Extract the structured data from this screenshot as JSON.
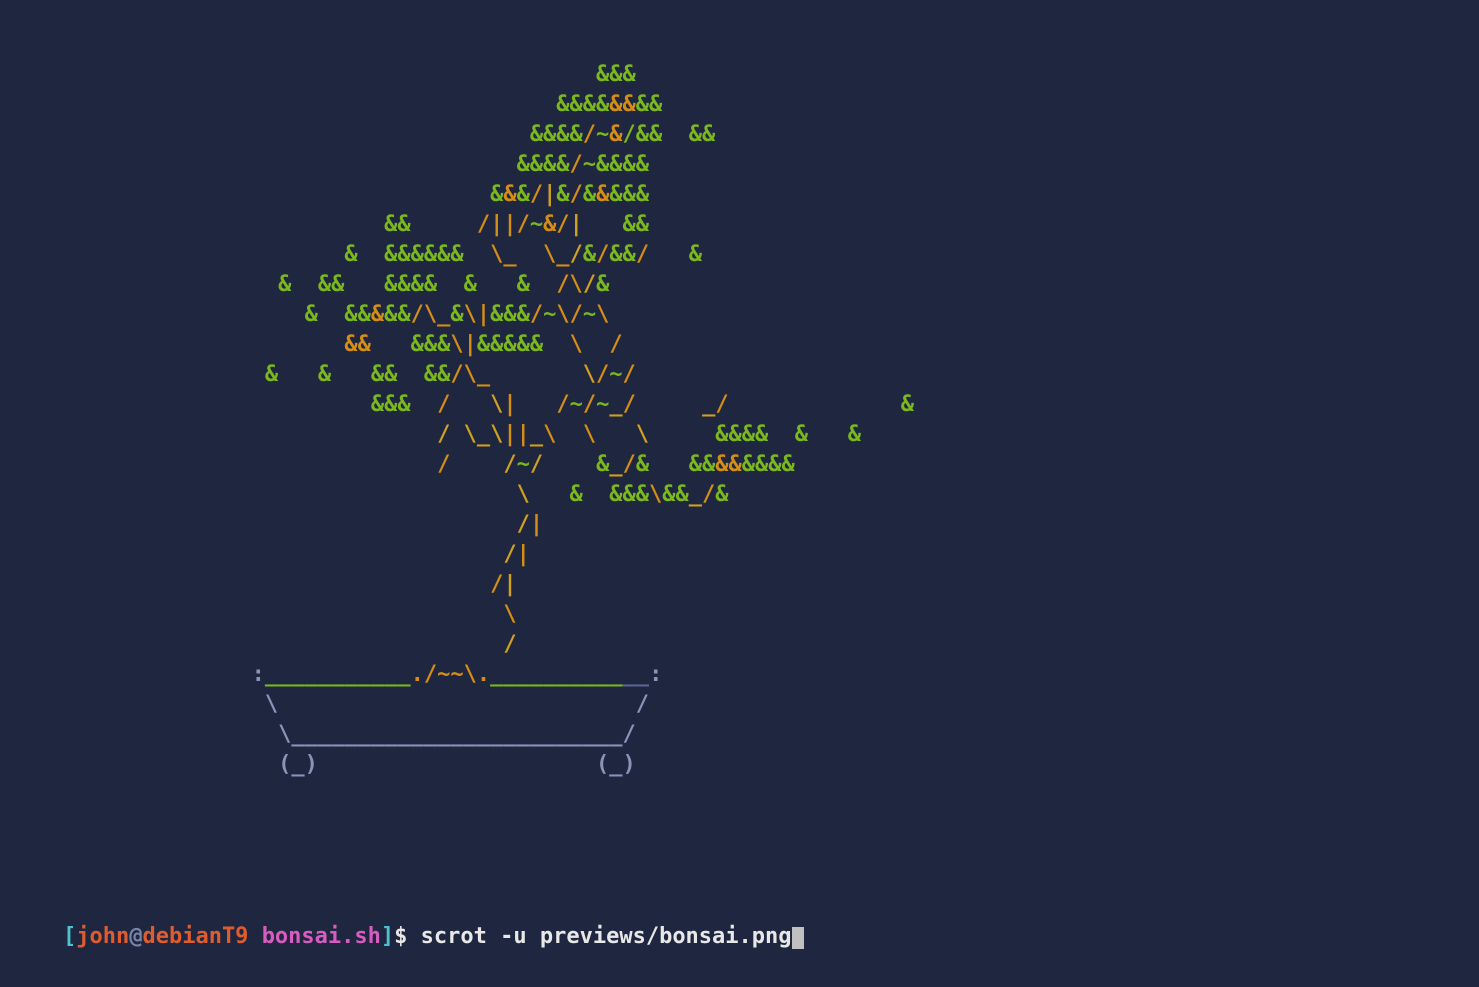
{
  "terminal": {
    "background": "#1f2640",
    "colors": {
      "green": "#7ab81e",
      "orange": "#d48e15",
      "yellow": "#d0a020",
      "pot": "#8a93b8",
      "pot_dark": "#5a6590",
      "grey": "#7a84a8",
      "white": "#e8e8e8",
      "red": "#e05c2e",
      "magenta": "#d85cc0",
      "cyan": "#4fc1cc"
    }
  },
  "tree": {
    "lines": [
      {
        "indent": "                                             ",
        "segs": [
          [
            "green",
            "&&&"
          ]
        ]
      },
      {
        "indent": "                                          ",
        "segs": [
          [
            "green",
            "&&&&"
          ],
          [
            "orange",
            "&&"
          ],
          [
            "green",
            "&&"
          ]
        ]
      },
      {
        "indent": "                                        ",
        "segs": [
          [
            "green",
            "&&&&"
          ],
          [
            "orange",
            "/"
          ],
          [
            "green",
            "~"
          ],
          [
            "orange",
            "&"
          ],
          [
            "green",
            "/&&  &&"
          ]
        ]
      },
      {
        "indent": "                                       ",
        "segs": [
          [
            "green",
            "&&&&"
          ],
          [
            "orange",
            "/"
          ],
          [
            "green",
            "~&&&&"
          ]
        ]
      },
      {
        "indent": "                                     ",
        "segs": [
          [
            "green",
            "&"
          ],
          [
            "orange",
            "&"
          ],
          [
            "green",
            "&"
          ],
          [
            "orange",
            "/"
          ],
          [
            "yellow",
            "|"
          ],
          [
            "green",
            "&"
          ],
          [
            "orange",
            "/"
          ],
          [
            "green",
            "&"
          ],
          [
            "orange",
            "&"
          ],
          [
            "green",
            "&&&"
          ]
        ]
      },
      {
        "indent": "                             ",
        "segs": [
          [
            "green",
            "&&     "
          ],
          [
            "orange",
            "/||/"
          ],
          [
            "green",
            "~"
          ],
          [
            "orange",
            "&/"
          ],
          [
            "yellow",
            "|"
          ],
          [
            "green",
            "   &&"
          ]
        ]
      },
      {
        "indent": "                          ",
        "segs": [
          [
            "green",
            "&  &&&&&&  "
          ],
          [
            "orange",
            "\\_  \\_"
          ],
          [
            "yellow",
            "/"
          ],
          [
            "green",
            "&"
          ],
          [
            "orange",
            "/"
          ],
          [
            "green",
            "&&"
          ],
          [
            "orange",
            "/"
          ],
          [
            "green",
            "   &"
          ]
        ]
      },
      {
        "indent": "                     ",
        "segs": [
          [
            "green",
            "&  &&   &&&&  &   &  "
          ],
          [
            "orange",
            "/\\"
          ],
          [
            "yellow",
            "/"
          ],
          [
            "green",
            "&"
          ]
        ]
      },
      {
        "indent": "                       ",
        "segs": [
          [
            "green",
            "&  &&"
          ],
          [
            "orange",
            "&"
          ],
          [
            "green",
            "&&"
          ],
          [
            "orange",
            "/\\_"
          ],
          [
            "green",
            "&"
          ],
          [
            "orange",
            "\\|"
          ],
          [
            "green",
            "&&&"
          ],
          [
            "orange",
            "/"
          ],
          [
            "green",
            "~"
          ],
          [
            "orange",
            "\\/"
          ],
          [
            "green",
            "~"
          ],
          [
            "orange",
            "\\"
          ]
        ]
      },
      {
        "indent": "                          ",
        "segs": [
          [
            "orange",
            "&&"
          ],
          [
            "green",
            "   &&&"
          ],
          [
            "orange",
            "\\|"
          ],
          [
            "green",
            "&&&&&  "
          ],
          [
            "orange",
            "\\  /"
          ]
        ]
      },
      {
        "indent": "                    ",
        "segs": [
          [
            "green",
            "&   &   &&  &&"
          ],
          [
            "orange",
            "/\\_       "
          ],
          [
            "yellow",
            "\\"
          ],
          [
            "orange",
            "/"
          ],
          [
            "green",
            "~"
          ],
          [
            "orange",
            "/"
          ]
        ]
      },
      {
        "indent": "                            ",
        "segs": [
          [
            "green",
            "&&&  "
          ],
          [
            "orange",
            "/   "
          ],
          [
            "yellow",
            "\\"
          ],
          [
            "orange",
            "|   /"
          ],
          [
            "green",
            "~"
          ],
          [
            "orange",
            "/"
          ],
          [
            "green",
            "~"
          ],
          [
            "yellow",
            "_"
          ],
          [
            "orange",
            "/     "
          ],
          [
            "yellow",
            "_"
          ],
          [
            "orange",
            "/"
          ],
          [
            "green",
            "             &"
          ]
        ]
      },
      {
        "indent": "                                 ",
        "segs": [
          [
            "yellow",
            "/ \\_\\"
          ],
          [
            "orange",
            "||"
          ],
          [
            "yellow",
            "_"
          ],
          [
            "orange",
            "\\  \\   "
          ],
          [
            "yellow",
            "\\"
          ],
          [
            "orange",
            "     "
          ],
          [
            "green",
            "&&&&  &   &"
          ]
        ]
      },
      {
        "indent": "                                 ",
        "segs": [
          [
            "orange",
            "/"
          ],
          [
            "yellow",
            "    /"
          ],
          [
            "green",
            "~"
          ],
          [
            "yellow",
            "/    "
          ],
          [
            "green",
            "&"
          ],
          [
            "yellow",
            "_"
          ],
          [
            "orange",
            "/"
          ],
          [
            "green",
            "&   &&"
          ],
          [
            "orange",
            "&&"
          ],
          [
            "green",
            "&&&&"
          ]
        ]
      },
      {
        "indent": "                                       ",
        "segs": [
          [
            "yellow",
            "\\   "
          ],
          [
            "green",
            "&  &&&"
          ],
          [
            "orange",
            "\\"
          ],
          [
            "green",
            "&&"
          ],
          [
            "yellow",
            "_"
          ],
          [
            "orange",
            "/"
          ],
          [
            "green",
            "&"
          ]
        ]
      },
      {
        "indent": "                                       ",
        "segs": [
          [
            "yellow",
            "/"
          ],
          [
            "orange",
            "|"
          ]
        ]
      },
      {
        "indent": "                                      ",
        "segs": [
          [
            "yellow",
            "/"
          ],
          [
            "orange",
            "|"
          ]
        ]
      },
      {
        "indent": "                                     ",
        "segs": [
          [
            "orange",
            "/"
          ],
          [
            "yellow",
            "|"
          ]
        ]
      },
      {
        "indent": "                                      ",
        "segs": [
          [
            "orange",
            "\\"
          ]
        ]
      },
      {
        "indent": "                                      ",
        "segs": [
          [
            "yellow",
            "/"
          ]
        ]
      },
      {
        "indent": "                   ",
        "segs": [
          [
            "pot",
            ":"
          ],
          [
            "green",
            "___________"
          ],
          [
            "orange",
            "./~~\\."
          ],
          [
            "green",
            "__________"
          ],
          [
            "pot-dk",
            "__"
          ],
          [
            "pot",
            ":"
          ]
        ]
      },
      {
        "indent": "                    ",
        "segs": [
          [
            "pot",
            "\\                           /"
          ]
        ]
      },
      {
        "indent": "                     ",
        "segs": [
          [
            "pot",
            "\\_________________________/"
          ]
        ]
      },
      {
        "indent": "                     ",
        "segs": [
          [
            "pot",
            "(_)                     (_)"
          ]
        ]
      }
    ]
  },
  "prompt": {
    "bracket_open": "[",
    "user": "john",
    "at": "@",
    "host": "debianT9",
    "cwd": "bonsai.sh",
    "bracket_close": "]",
    "symbol": "$ ",
    "command": "scrot -u previews/bonsai.png"
  }
}
